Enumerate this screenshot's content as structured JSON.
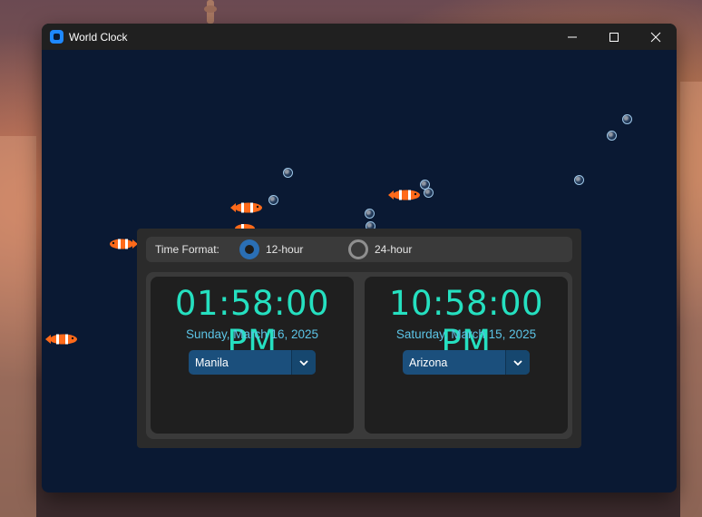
{
  "window": {
    "title": "World Clock",
    "icons": [
      "app-icon",
      "minimize-icon",
      "maximize-icon",
      "close-icon"
    ]
  },
  "format": {
    "label": "Time Format:",
    "options": [
      "12-hour",
      "24-hour"
    ],
    "selected": "12-hour"
  },
  "clocks": [
    {
      "time": "01:58:00 PM",
      "date": "Sunday, March 16, 2025",
      "zone": "Manila"
    },
    {
      "time": "10:58:00 PM",
      "date": "Saturday, March 15, 2025",
      "zone": "Arizona"
    }
  ],
  "colors": {
    "window_bg": "#0a1933",
    "titlebar": "#202020",
    "time_text": "#25e0c0",
    "date_text": "#5cc4e6",
    "select_bg": "#1b4f7c",
    "radio_on": "#2a6fb5",
    "fish_orange": "#ff6a1a"
  },
  "decor": {
    "aquarium": {
      "fish_count": 5,
      "bubble_count": 11
    }
  }
}
